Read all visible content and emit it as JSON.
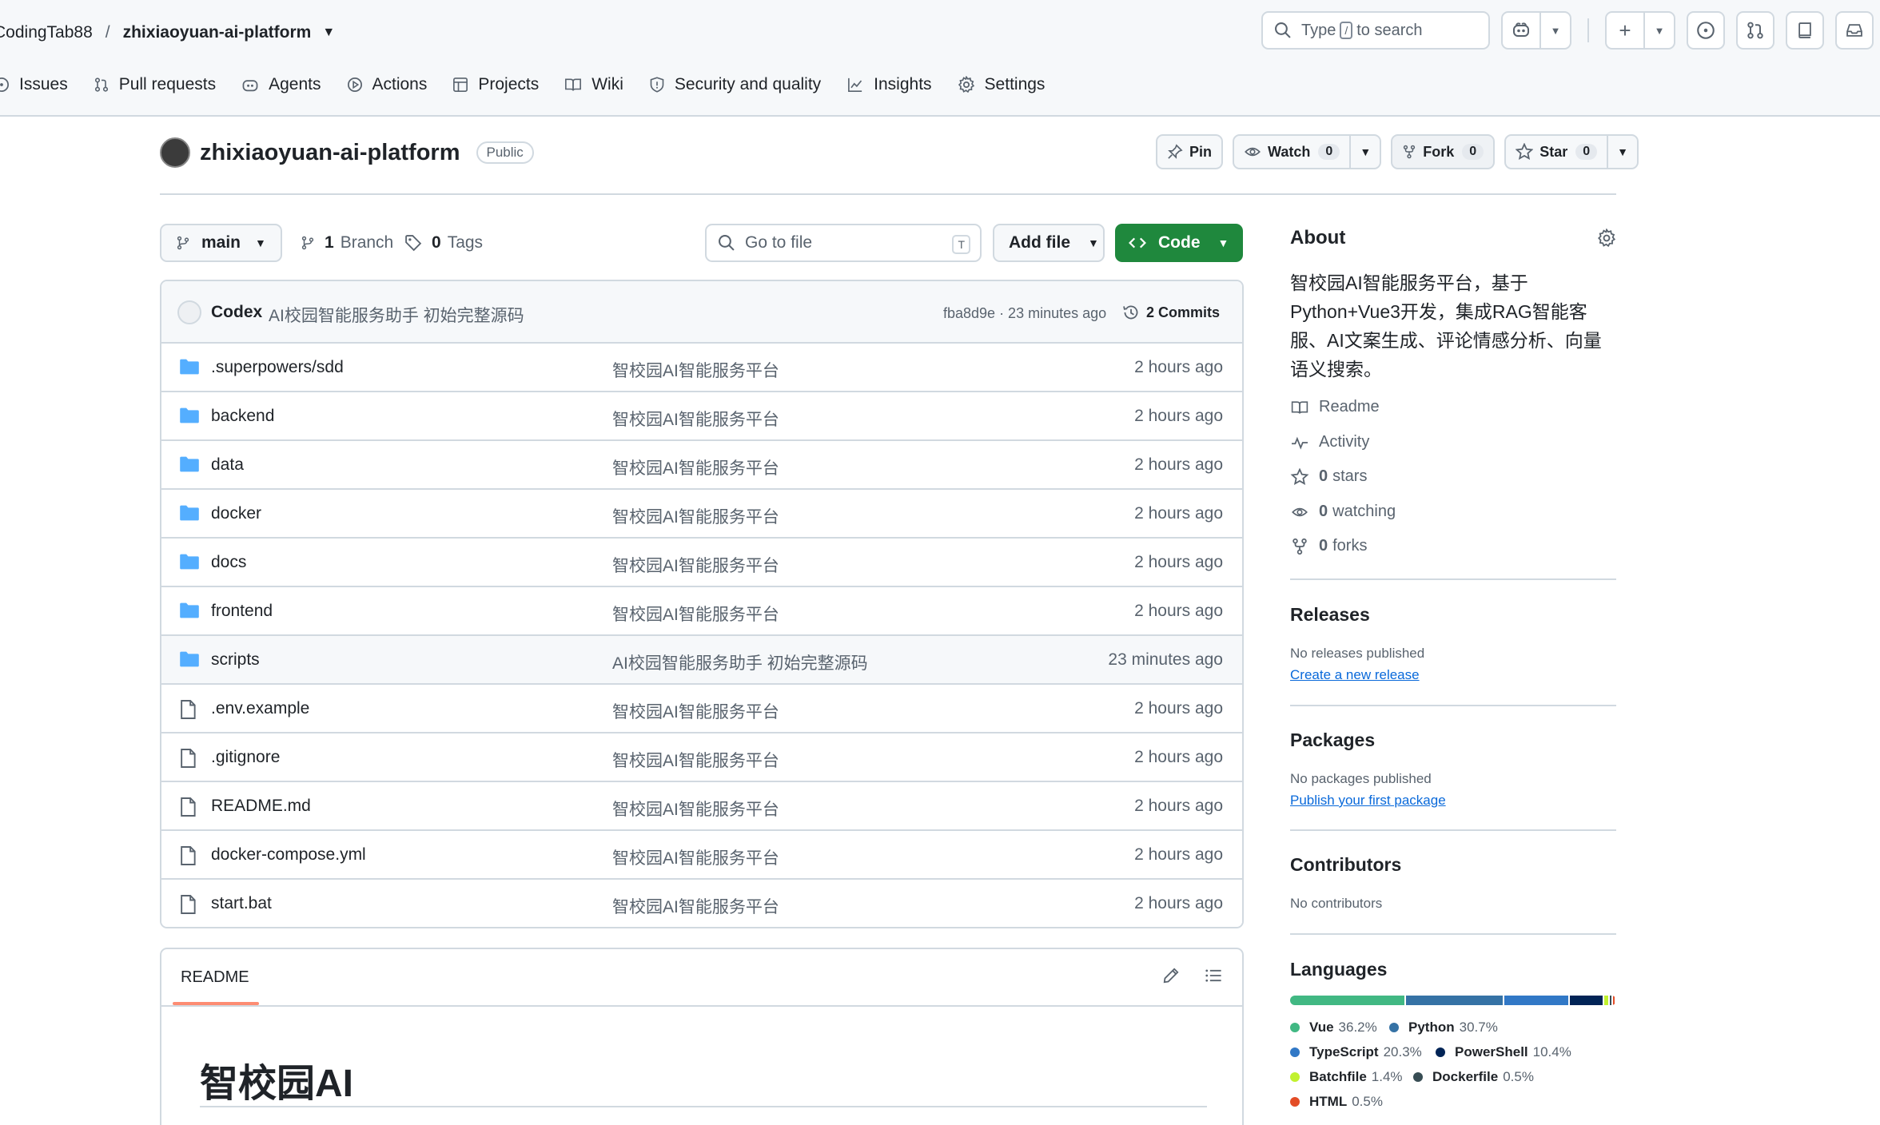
{
  "header": {
    "owner": "CodingTab88",
    "separator": "/",
    "repo": "zhixiaoyuan-ai-platform",
    "search_type": "Type",
    "search_key": "/",
    "search_rest": "to search"
  },
  "nav": [
    {
      "label": "Issues",
      "icon": "issues-icon"
    },
    {
      "label": "Pull requests",
      "icon": "pull-request-icon"
    },
    {
      "label": "Agents",
      "icon": "agents-icon"
    },
    {
      "label": "Actions",
      "icon": "actions-icon"
    },
    {
      "label": "Projects",
      "icon": "projects-icon"
    },
    {
      "label": "Wiki",
      "icon": "wiki-icon"
    },
    {
      "label": "Security and quality",
      "icon": "shield-icon"
    },
    {
      "label": "Insights",
      "icon": "graph-icon"
    },
    {
      "label": "Settings",
      "icon": "gear-icon"
    }
  ],
  "repo": {
    "name": "zhixiaoyuan-ai-platform",
    "visibility": "Public",
    "pin_label": "Pin",
    "watch_label": "Watch",
    "watch_count": "0",
    "fork_label": "Fork",
    "fork_count": "0",
    "star_label": "Star",
    "star_count": "0"
  },
  "branchbar": {
    "branch": "main",
    "branches_count": "1",
    "branches_label": "Branch",
    "tags_count": "0",
    "tags_label": "Tags",
    "goto_placeholder": "Go to file",
    "goto_key": "T",
    "add_file": "Add file",
    "code": "Code"
  },
  "commit": {
    "author": "Codex",
    "message": "AI校园智能服务助手 初始完整源码",
    "hash_time": "fba8d9e · 23 minutes ago",
    "commits": "2 Commits"
  },
  "files": [
    {
      "name": ".superpowers/sdd",
      "type": "folder",
      "message": "智校园AI智能服务平台",
      "time": "2 hours ago"
    },
    {
      "name": "backend",
      "type": "folder",
      "message": "智校园AI智能服务平台",
      "time": "2 hours ago"
    },
    {
      "name": "data",
      "type": "folder",
      "message": "智校园AI智能服务平台",
      "time": "2 hours ago"
    },
    {
      "name": "docker",
      "type": "folder",
      "message": "智校园AI智能服务平台",
      "time": "2 hours ago"
    },
    {
      "name": "docs",
      "type": "folder",
      "message": "智校园AI智能服务平台",
      "time": "2 hours ago"
    },
    {
      "name": "frontend",
      "type": "folder",
      "message": "智校园AI智能服务平台",
      "time": "2 hours ago"
    },
    {
      "name": "scripts",
      "type": "folder",
      "message": "AI校园智能服务助手 初始完整源码",
      "time": "23 minutes ago"
    },
    {
      "name": ".env.example",
      "type": "file",
      "message": "智校园AI智能服务平台",
      "time": "2 hours ago"
    },
    {
      "name": ".gitignore",
      "type": "file",
      "message": "智校园AI智能服务平台",
      "time": "2 hours ago"
    },
    {
      "name": "README.md",
      "type": "file",
      "message": "智校园AI智能服务平台",
      "time": "2 hours ago"
    },
    {
      "name": "docker-compose.yml",
      "type": "file",
      "message": "智校园AI智能服务平台",
      "time": "2 hours ago"
    },
    {
      "name": "start.bat",
      "type": "file",
      "message": "智校园AI智能服务平台",
      "time": "2 hours ago"
    }
  ],
  "readme": {
    "tab": "README",
    "heading": "智校园AI"
  },
  "about": {
    "title": "About",
    "description": "智校园AI智能服务平台，基于Python+Vue3开发，集成RAG智能客服、AI文案生成、评论情感分析、向量语义搜索。",
    "readme": "Readme",
    "activity": "Activity",
    "stars_count": "0",
    "stars_label": "stars",
    "watching_count": "0",
    "watching_label": "watching",
    "forks_count": "0",
    "forks_label": "forks"
  },
  "releases": {
    "title": "Releases",
    "empty": "No releases published",
    "link": "Create a new release"
  },
  "packages": {
    "title": "Packages",
    "empty": "No packages published",
    "link": "Publish your first package"
  },
  "contributors": {
    "title": "Contributors",
    "empty": "No contributors"
  },
  "languages": {
    "title": "Languages",
    "items": [
      {
        "name": "Vue",
        "pct": "36.2%",
        "value": 36.2,
        "color": "#41b883"
      },
      {
        "name": "Python",
        "pct": "30.7%",
        "value": 30.7,
        "color": "#3572a5"
      },
      {
        "name": "TypeScript",
        "pct": "20.3%",
        "value": 20.3,
        "color": "#3178c6"
      },
      {
        "name": "PowerShell",
        "pct": "10.4%",
        "value": 10.4,
        "color": "#012456"
      },
      {
        "name": "Batchfile",
        "pct": "1.4%",
        "value": 1.4,
        "color": "#c1f12e"
      },
      {
        "name": "Dockerfile",
        "pct": "0.5%",
        "value": 0.5,
        "color": "#384d54"
      },
      {
        "name": "HTML",
        "pct": "0.5%",
        "value": 0.5,
        "color": "#e34c26"
      }
    ]
  }
}
